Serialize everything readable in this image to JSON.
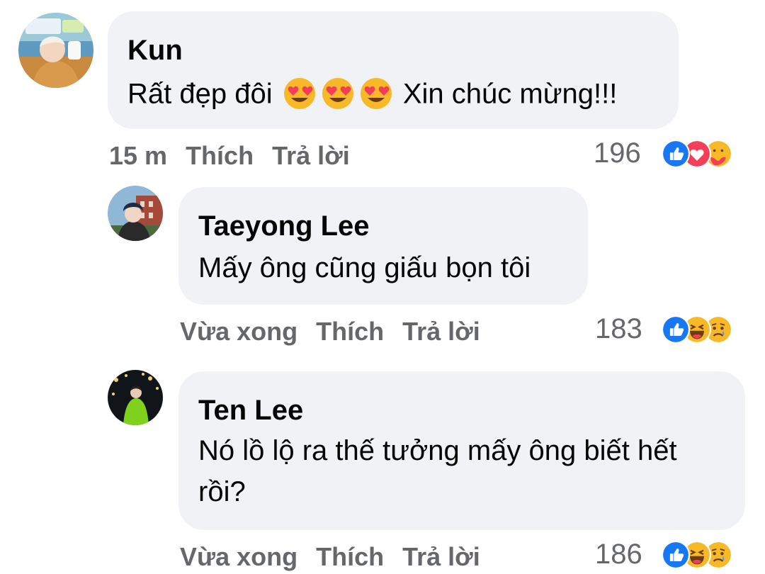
{
  "comments": [
    {
      "author": "Kun",
      "text_before": "Rất đẹp đôi",
      "emoji_icons": [
        "heart-eyes-emoji",
        "heart-eyes-emoji",
        "heart-eyes-emoji"
      ],
      "text_after": "Xin chúc mừng!!!",
      "time": "15 m",
      "like_label": "Thích",
      "reply_label": "Trả lời",
      "reaction_count": "196",
      "reaction_icons": [
        "like-icon",
        "love-icon",
        "care-icon"
      ]
    },
    {
      "author": "Taeyong Lee",
      "text": "Mấy ông cũng giấu bọn tôi",
      "time": "Vừa xong",
      "like_label": "Thích",
      "reply_label": "Trả lời",
      "reaction_count": "183",
      "reaction_icons": [
        "like-icon",
        "haha-icon",
        "sad-icon"
      ]
    },
    {
      "author": "Ten Lee",
      "text_line1": "Nó lồ lộ ra thế tưởng mấy ông biết hết",
      "text_line2": "rồi?",
      "time": "Vừa xong",
      "like_label": "Thích",
      "reply_label": "Trả lời",
      "reaction_count": "186",
      "reaction_icons": [
        "like-icon",
        "haha-icon",
        "sad-icon"
      ]
    }
  ],
  "colors": {
    "bubble": "#f0f2f5",
    "secondary_text": "#65676b",
    "like_blue": "#1877f2",
    "love_red": "#f33e58",
    "emoji_yellow": "#f7b928"
  }
}
